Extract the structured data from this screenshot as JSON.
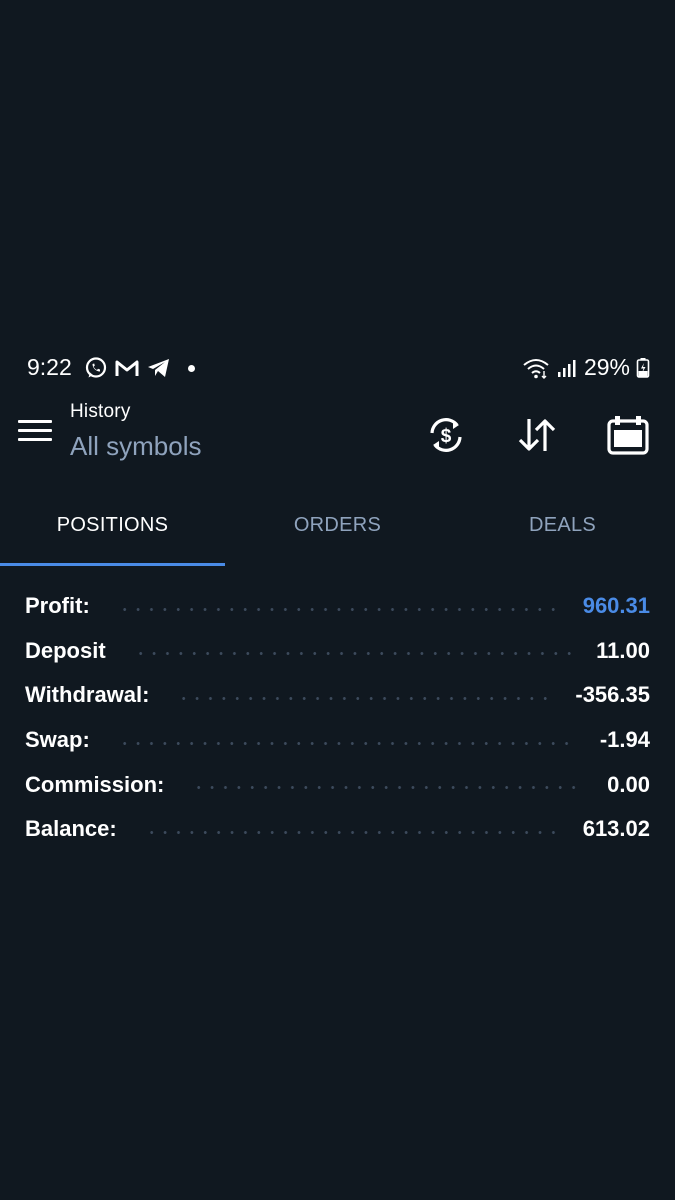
{
  "status_bar": {
    "time": "9:22",
    "left_icons": [
      "whatsapp-icon",
      "gmail-icon",
      "telegram-icon"
    ],
    "right_icons": [
      "wifi-icon",
      "signal-icon"
    ],
    "battery_percent": "29%"
  },
  "header": {
    "title": "History",
    "subtitle": "All symbols",
    "actions": [
      "currency-exchange-icon",
      "sort-icon",
      "calendar-icon"
    ]
  },
  "tabs": [
    {
      "label": "POSITIONS",
      "active": true
    },
    {
      "label": "ORDERS",
      "active": false
    },
    {
      "label": "DEALS",
      "active": false
    }
  ],
  "summary": [
    {
      "label": "Profit:",
      "value": "960.31",
      "accent": true
    },
    {
      "label": "Deposit",
      "value": "11.00",
      "accent": false
    },
    {
      "label": "Withdrawal:",
      "value": "-356.35",
      "accent": false
    },
    {
      "label": "Swap:",
      "value": "-1.94",
      "accent": false
    },
    {
      "label": "Commission:",
      "value": "0.00",
      "accent": false
    },
    {
      "label": "Balance:",
      "value": "613.02",
      "accent": false
    }
  ],
  "colors": {
    "background": "#101820",
    "accent": "#4a8be6",
    "muted_text": "#8fa3bd",
    "dots": "#3c4a5c"
  }
}
